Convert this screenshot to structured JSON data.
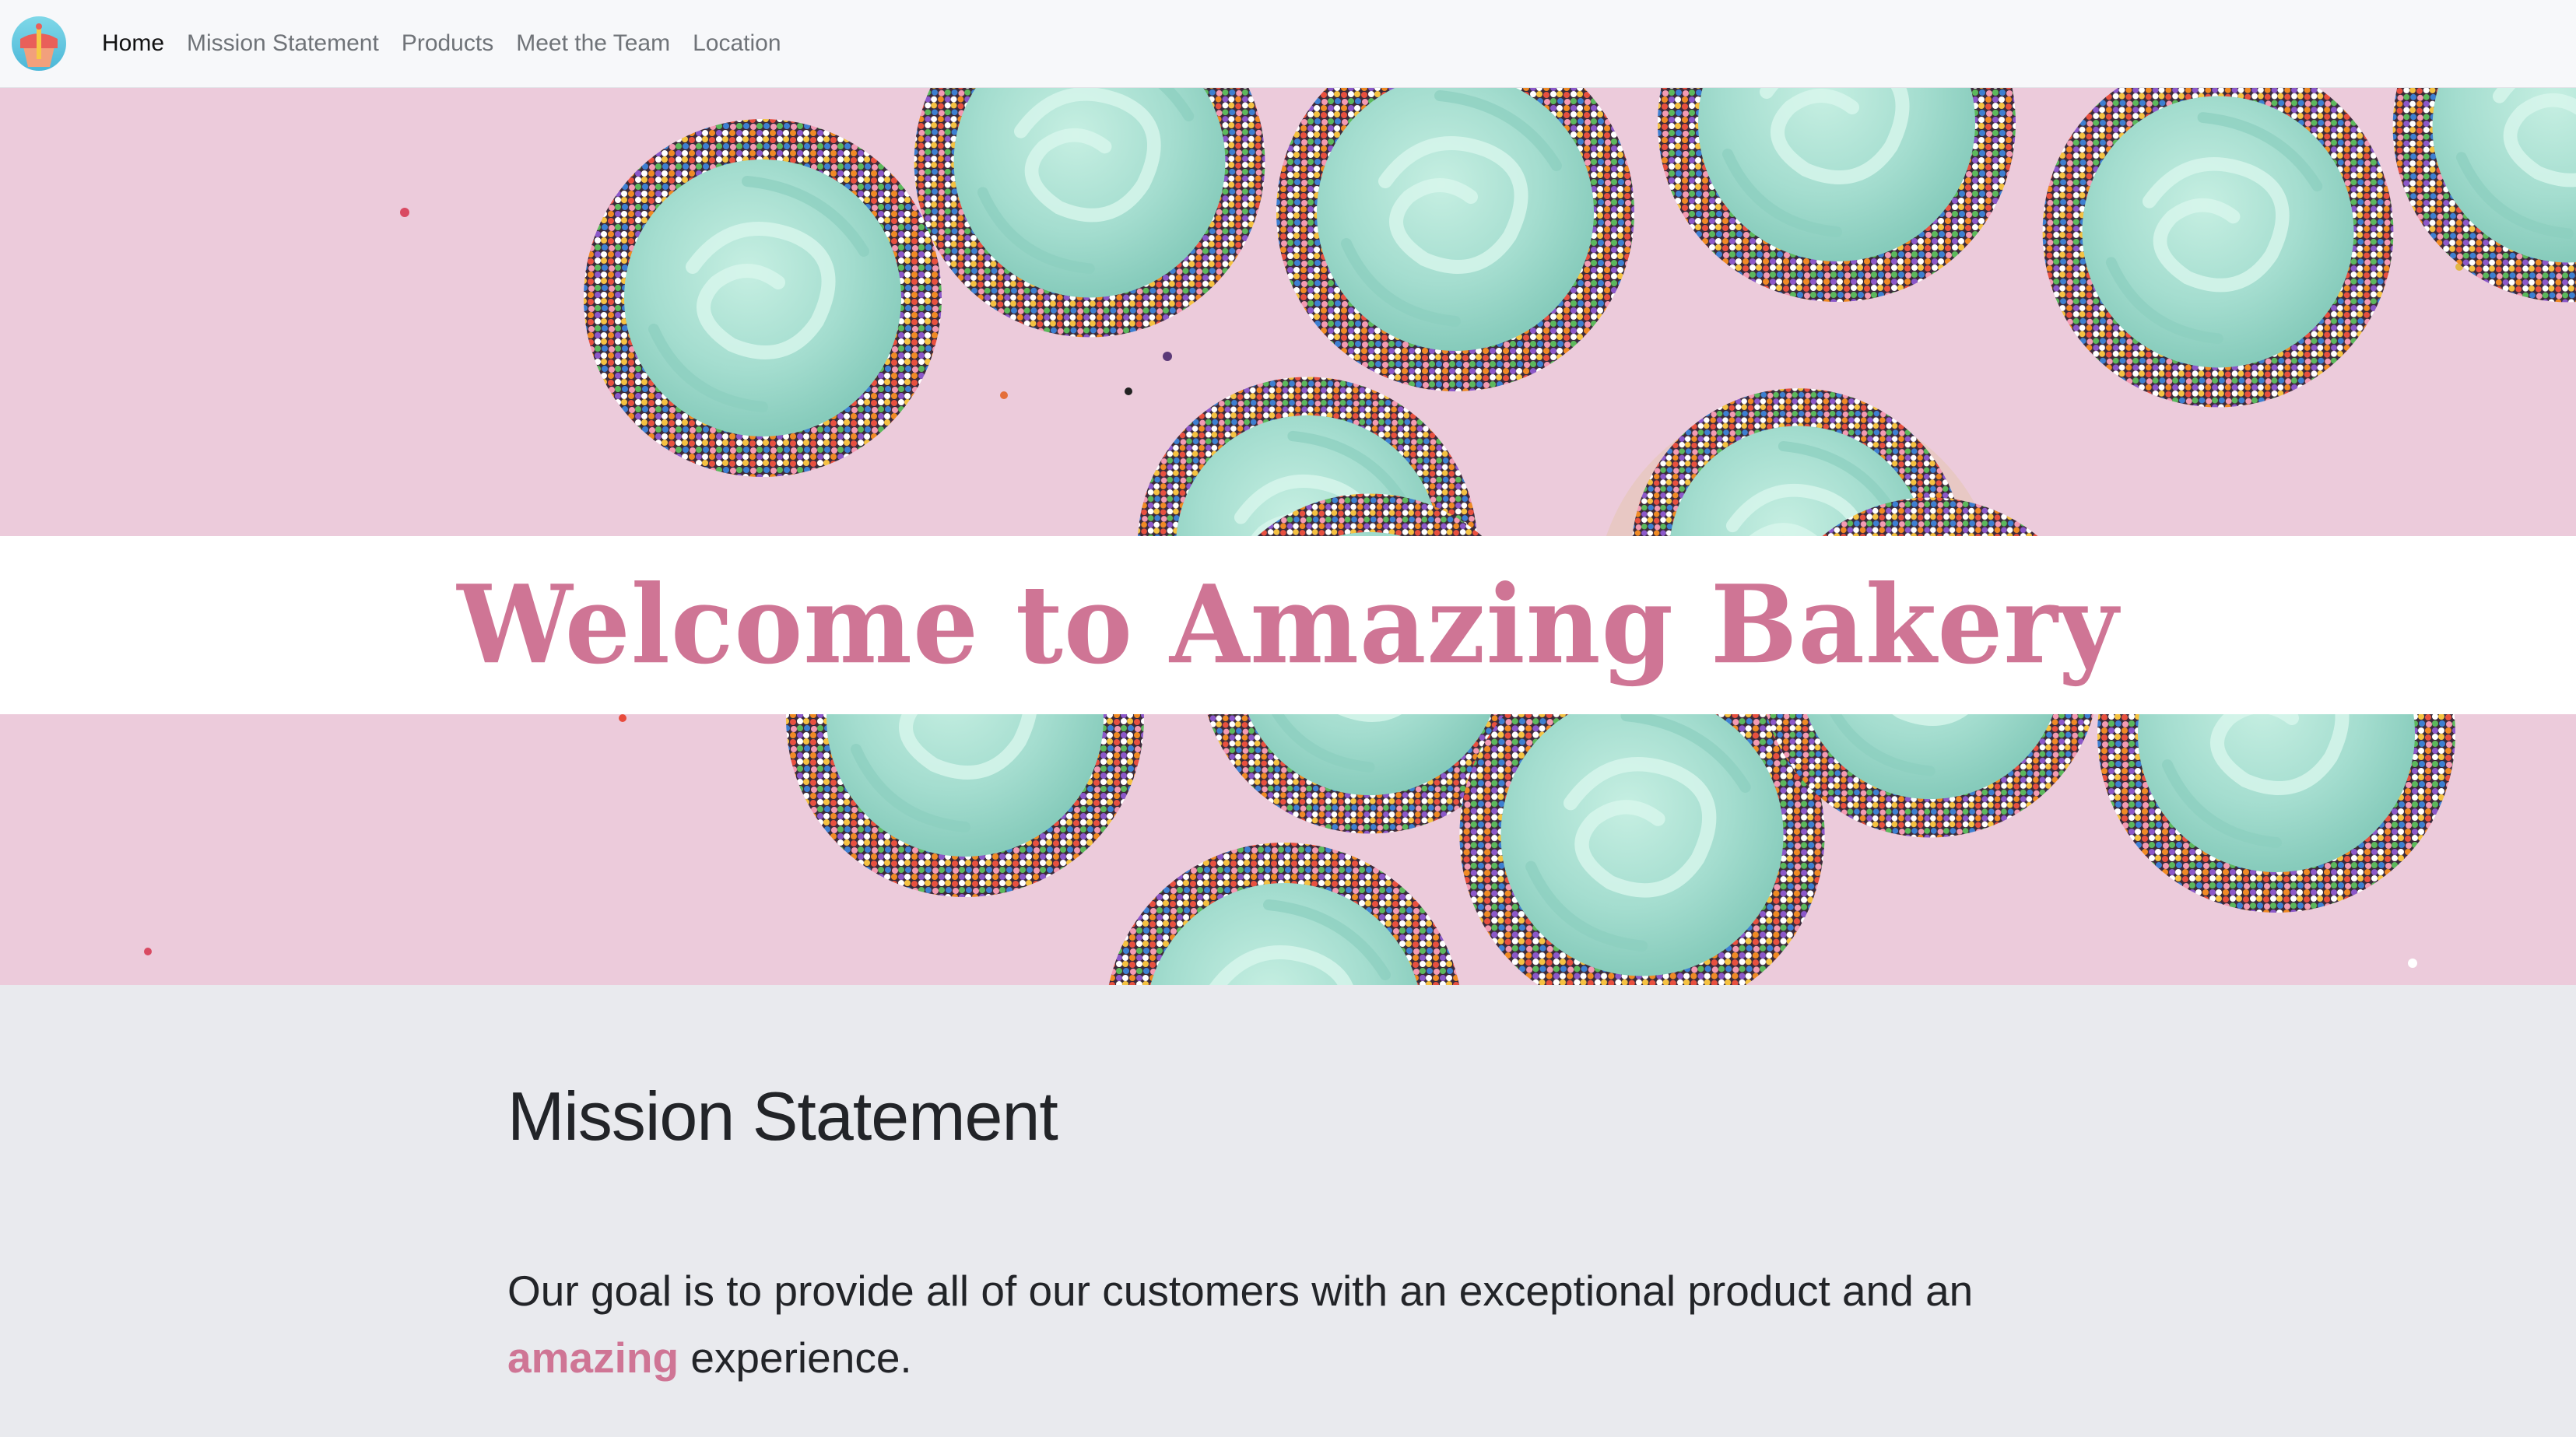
{
  "nav": {
    "logo_icon": "cupcake-logo-icon",
    "items": [
      {
        "label": "Home",
        "active": true
      },
      {
        "label": "Mission Statement",
        "active": false
      },
      {
        "label": "Products",
        "active": false
      },
      {
        "label": "Meet the Team",
        "active": false
      },
      {
        "label": "Location",
        "active": false
      }
    ]
  },
  "hero": {
    "image": "cupcakes-with-mint-frosting-and-sprinkles",
    "title": "Welcome to Amazing Bakery"
  },
  "mission": {
    "heading": "Mission Statement",
    "text_before": "Our goal is to provide all of our customers with an exceptional product and an",
    "highlight": "amazing",
    "text_after": "experience."
  },
  "colors": {
    "accent": "#cf7595",
    "background": "#e9eaee",
    "navbar": "#f7f8fa",
    "hero_pink": "#eccbdb",
    "frosting": "#a6ded0"
  }
}
